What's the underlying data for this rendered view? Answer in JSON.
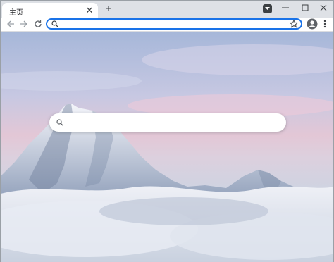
{
  "tab": {
    "title": "主页"
  },
  "omnibox": {
    "value": "",
    "placeholder": ""
  },
  "ntp_search": {
    "value": "",
    "placeholder": ""
  },
  "icons": {
    "tab_close": "close-icon",
    "new_tab": "plus-icon",
    "tab_search": "chevron-down-icon",
    "minimize": "minimize-icon",
    "maximize": "maximize-icon",
    "window_close": "close-icon",
    "back": "back-arrow-icon",
    "forward": "forward-arrow-icon",
    "reload": "reload-icon",
    "search": "search-icon",
    "bookmark": "star-icon",
    "profile": "account-icon",
    "menu": "more-vert-icon"
  },
  "colors": {
    "accent": "#1a73e8",
    "tabstrip": "#dee1e6",
    "toolbar": "#ffffff"
  }
}
